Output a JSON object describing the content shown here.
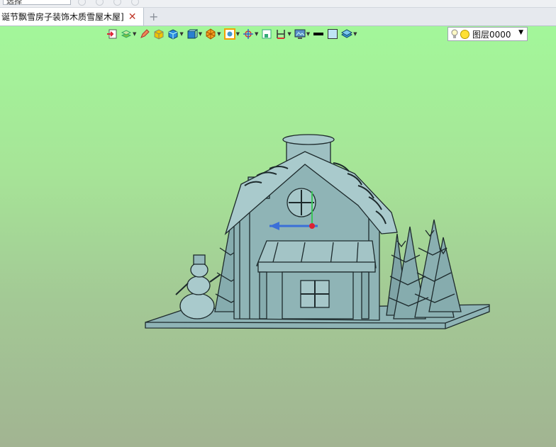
{
  "top": {
    "select_label": "选择"
  },
  "tabs": [
    {
      "label": "诞节飘雪房子装饰木质雪屋木屋]",
      "active": true
    }
  ],
  "tab_add_label": "+",
  "tab_close_label": "✕",
  "toolbar": {
    "icons": [
      "exit-sketch-icon",
      "layer-manage-icon",
      "pencil-icon",
      "solid-shaded-icon",
      "blue-cube-icon",
      "view-cube-icon",
      "pie-render-icon",
      "frame-view-icon",
      "axis-target-icon",
      "box-select-icon",
      "dimension-icon",
      "display-icon",
      "line-color-icon",
      "face-color-icon",
      "layer-stack-icon"
    ]
  },
  "layer": {
    "name": "图层0000"
  },
  "colors": {
    "viewport_top": "#a3f79a",
    "viewport_bottom": "#a2b492",
    "model": "#8fb4b6",
    "model_dark": "#1d2a2c"
  }
}
